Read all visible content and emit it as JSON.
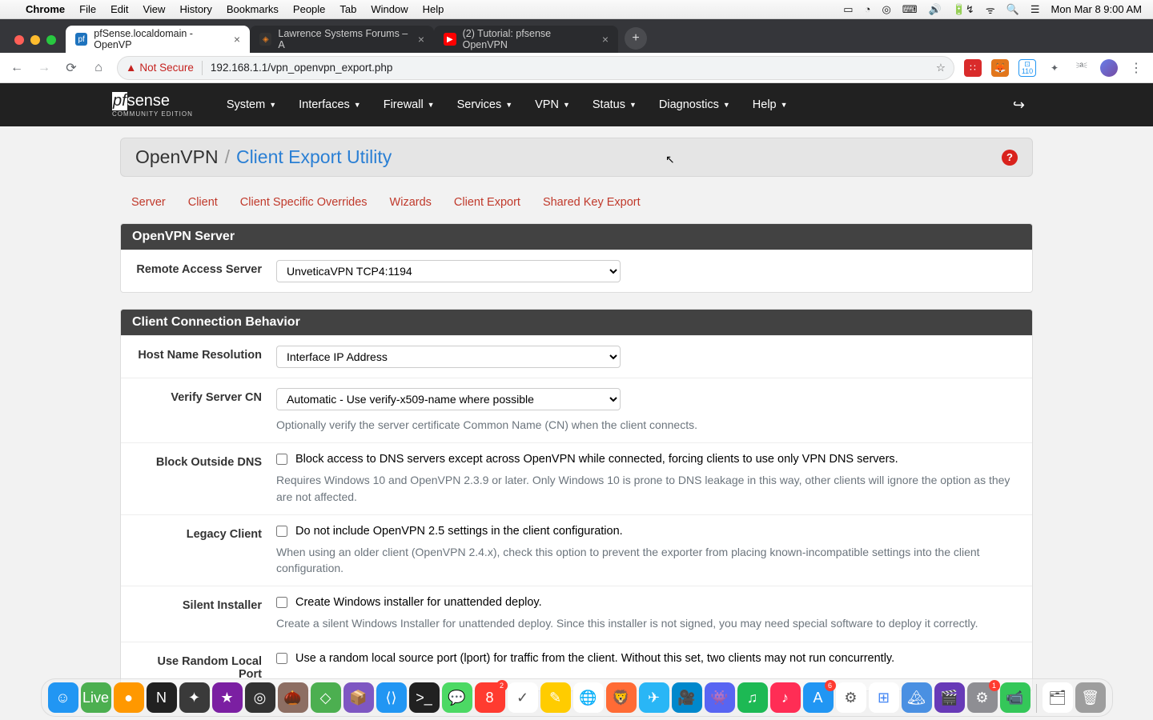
{
  "menubar": {
    "app": "Chrome",
    "items": [
      "File",
      "Edit",
      "View",
      "History",
      "Bookmarks",
      "People",
      "Tab",
      "Window",
      "Help"
    ],
    "clock": "Mon Mar 8  9:00 AM",
    "badge": "110"
  },
  "tabs": [
    {
      "title": "pfSense.localdomain - OpenVP",
      "active": true,
      "favcolor": "#1e73be",
      "favtxt": "pf"
    },
    {
      "title": "Lawrence Systems Forums – A",
      "active": false,
      "favcolor": "#e67e22",
      "favtxt": "◈"
    },
    {
      "title": "(2) Tutorial: pfsense OpenVPN",
      "active": false,
      "favcolor": "#ff0000",
      "favtxt": "▶"
    }
  ],
  "omni": {
    "not_secure": "Not Secure",
    "url": "192.168.1.1/vpn_openvpn_export.php"
  },
  "pfs": {
    "logo_sub": "COMMUNITY EDITION",
    "nav": [
      "System",
      "Interfaces",
      "Firewall",
      "Services",
      "VPN",
      "Status",
      "Diagnostics",
      "Help"
    ]
  },
  "crumb": {
    "a": "OpenVPN",
    "b": "Client Export Utility"
  },
  "subtabs": [
    "Server",
    "Client",
    "Client Specific Overrides",
    "Wizards",
    "Client Export",
    "Shared Key Export"
  ],
  "panel1": {
    "title": "OpenVPN Server",
    "row1": {
      "label": "Remote Access Server",
      "value": "UnveticaVPN TCP4:1194"
    }
  },
  "panel2": {
    "title": "Client Connection Behavior",
    "host": {
      "label": "Host Name Resolution",
      "value": "Interface IP Address"
    },
    "verify": {
      "label": "Verify Server CN",
      "value": "Automatic - Use verify-x509-name where possible",
      "help": "Optionally verify the server certificate Common Name (CN) when the client connects."
    },
    "block": {
      "label": "Block Outside DNS",
      "check": "Block access to DNS servers except across OpenVPN while connected, forcing clients to use only VPN DNS servers.",
      "help": "Requires Windows 10 and OpenVPN 2.3.9 or later. Only Windows 10 is prone to DNS leakage in this way, other clients will ignore the option as they are not affected."
    },
    "legacy": {
      "label": "Legacy Client",
      "check": "Do not include OpenVPN 2.5 settings in the client configuration.",
      "help": "When using an older client (OpenVPN 2.4.x), check this option to prevent the exporter from placing known-incompatible settings into the client configuration."
    },
    "silent": {
      "label": "Silent Installer",
      "check": "Create Windows installer for unattended deploy.",
      "help": "Create a silent Windows Installer for unattended deploy. Since this installer is not signed, you may need special software to deploy it correctly."
    },
    "random": {
      "label": "Use Random Local Port",
      "check": "Use a random local source port (lport) for traffic from the client. Without this set, two clients may not run concurrently."
    }
  },
  "dock": [
    {
      "c": "#2196f3",
      "t": "☺"
    },
    {
      "c": "#4caf50",
      "t": "Live"
    },
    {
      "c": "#ff9800",
      "t": "●"
    },
    {
      "c": "#212121",
      "t": "N"
    },
    {
      "c": "#3a3a3a",
      "t": "✦"
    },
    {
      "c": "#7b1fa2",
      "t": "★"
    },
    {
      "c": "#333",
      "t": "◎"
    },
    {
      "c": "#8d6e63",
      "t": "🌰"
    },
    {
      "c": "#4caf50",
      "t": "◇"
    },
    {
      "c": "#7e57c2",
      "t": "📦"
    },
    {
      "c": "#2196f3",
      "t": "⟨⟩"
    },
    {
      "c": "#212121",
      "t": ">_"
    },
    {
      "c": "#4cd964",
      "t": "💬"
    },
    {
      "c": "#ff3b30",
      "t": "8",
      "b": "2"
    },
    {
      "c": "#fff",
      "t": "✓",
      "fg": "#555"
    },
    {
      "c": "#ffcc00",
      "t": "✎"
    },
    {
      "c": "#fff",
      "t": "🌐"
    },
    {
      "c": "#ff6b35",
      "t": "🦁"
    },
    {
      "c": "#29b6f6",
      "t": "✈"
    },
    {
      "c": "#0088cc",
      "t": "🎥"
    },
    {
      "c": "#5865f2",
      "t": "👾"
    },
    {
      "c": "#1db954",
      "t": "♫"
    },
    {
      "c": "#ff2d55",
      "t": "♪"
    },
    {
      "c": "#2196f3",
      "t": "A",
      "b": "6"
    },
    {
      "c": "#fff",
      "t": "⚙",
      "fg": "#555"
    },
    {
      "c": "#fff",
      "t": "⊞",
      "fg": "#4285f4"
    },
    {
      "c": "#4a90e2",
      "t": "🏔"
    },
    {
      "c": "#673ab7",
      "t": "🎬"
    },
    {
      "c": "#8e8e93",
      "t": "⚙",
      "b": "1"
    },
    {
      "c": "#34c759",
      "t": "📹"
    }
  ]
}
